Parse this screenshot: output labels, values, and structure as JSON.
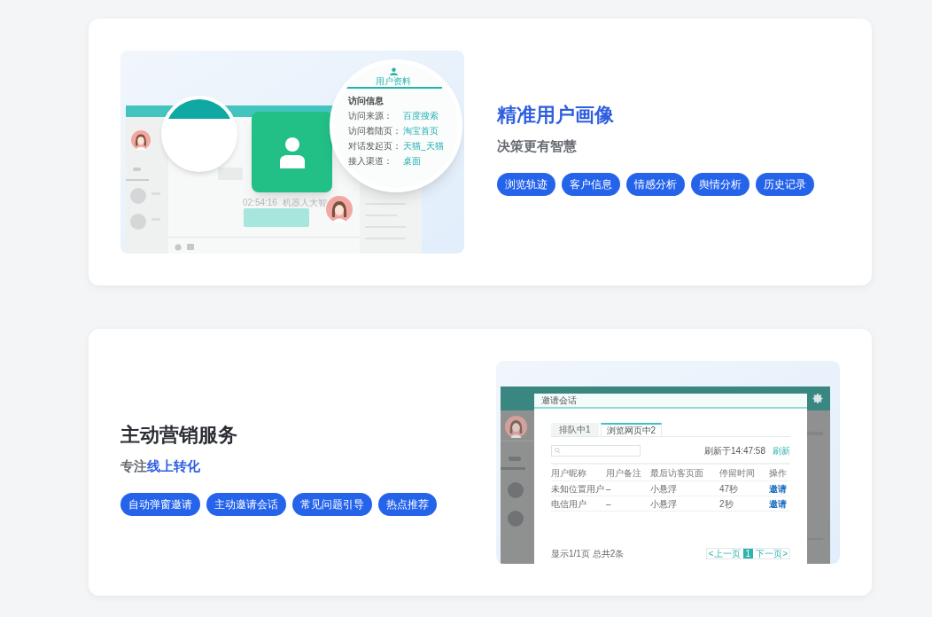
{
  "sections": [
    {
      "kind": "image-left",
      "title": "精准用户画像",
      "title_accent": true,
      "subtitle": [
        {
          "text": "决策更有智慧",
          "accent": false
        }
      ],
      "tags": [
        "浏览轨迹",
        "客户信息",
        "情感分析",
        "舆情分析",
        "历史记录"
      ],
      "illustration": {
        "kind": "profile",
        "profile_tab": "用户资料",
        "heading": "访问信息",
        "rows": [
          {
            "label": "访问来源：",
            "value": "百度搜索"
          },
          {
            "label": "访问着陆页：",
            "value": "淘宝首页"
          },
          {
            "label": "对话发起页：",
            "value": "天猫_天猫"
          },
          {
            "label": "接入渠道：",
            "value": "桌面"
          }
        ],
        "chat_time": "02:54:16",
        "chat_sender": "机器人大智"
      }
    },
    {
      "kind": "image-right",
      "title": "主动营销服务",
      "title_accent": false,
      "subtitle": [
        {
          "text": "专注",
          "accent": false
        },
        {
          "text": "线上转化",
          "accent": true
        }
      ],
      "tags": [
        "自动弹窗邀请",
        "主动邀请会话",
        "常见问题引导",
        "热点推荐"
      ],
      "illustration": {
        "kind": "invite",
        "dialog_title": "邀请会话",
        "tabs": [
          {
            "label": "排队中1",
            "selected": false
          },
          {
            "label": "浏览网页中2",
            "selected": true
          }
        ],
        "refresh_time": "刷新于14:47:58",
        "refresh_link": "刷新",
        "columns": [
          "用户昵称",
          "用户备注",
          "最后访客页面",
          "停留时间",
          "操作"
        ],
        "rows": [
          [
            "未知位置用户",
            "–",
            "小悬浮",
            "47秒",
            "邀请"
          ],
          [
            "电信用户",
            "–",
            "小悬浮",
            "2秒",
            "邀请"
          ]
        ],
        "footer": "显示1/1页 总共2条",
        "pagination": {
          "prev": "<上一页",
          "pages": [
            {
              "label": "1",
              "selected": true
            }
          ],
          "next": "下一页>"
        }
      }
    }
  ]
}
